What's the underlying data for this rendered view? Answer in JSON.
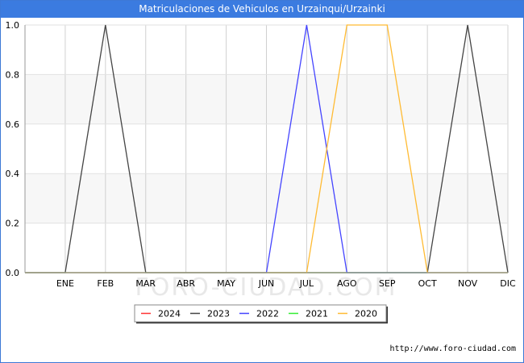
{
  "title": "Matriculaciones de Vehiculos en Urzainqui/Urzainki",
  "footer_url": "http://www.foro-ciudad.com",
  "watermark": "FORO-CIUDAD.COM",
  "chart_data": {
    "type": "line",
    "title": "Matriculaciones de Vehiculos en Urzainqui/Urzainki",
    "xlabel": "",
    "ylabel": "",
    "categories": [
      "",
      "ENE",
      "FEB",
      "MAR",
      "ABR",
      "MAY",
      "JUN",
      "JUL",
      "AGO",
      "SEP",
      "OCT",
      "NOV",
      "DIC"
    ],
    "ylim": [
      0,
      1.0
    ],
    "yticks": [
      "0.0",
      "0.2",
      "0.4",
      "0.6",
      "0.8",
      "1.0"
    ],
    "ytick_values": [
      0,
      0.2,
      0.4,
      0.6,
      0.8,
      1.0
    ],
    "grid": true,
    "legend_position": "bottom-center",
    "series": [
      {
        "name": "2024",
        "color": "#ff3333",
        "values": [
          0,
          0,
          0,
          0,
          0,
          0,
          0,
          0,
          0,
          0,
          0,
          0,
          0
        ]
      },
      {
        "name": "2023",
        "color": "#444444",
        "values": [
          0,
          0,
          1,
          0,
          0,
          0,
          0,
          0,
          0,
          0,
          0,
          1,
          0
        ]
      },
      {
        "name": "2022",
        "color": "#4444ff",
        "values": [
          0,
          0,
          0,
          0,
          0,
          0,
          0,
          1,
          0,
          0,
          0,
          0,
          0
        ]
      },
      {
        "name": "2021",
        "color": "#33ee33",
        "values": [
          0,
          0,
          0,
          0,
          0,
          0,
          0,
          0,
          0,
          0,
          0,
          0,
          0
        ]
      },
      {
        "name": "2020",
        "color": "#ffbb33",
        "values": [
          0,
          0,
          0,
          0,
          0,
          0,
          0,
          0,
          1,
          1,
          0,
          0,
          0
        ]
      }
    ]
  }
}
